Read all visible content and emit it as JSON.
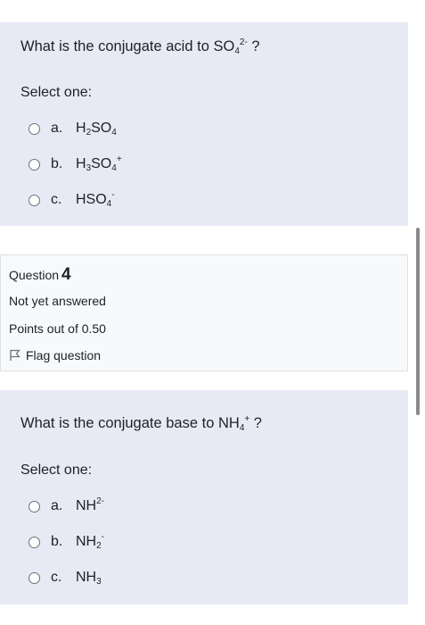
{
  "question3": {
    "text_pre": "What is the conjugate acid to SO",
    "text_sub": "4",
    "text_sup": "2-",
    "text_post": " ?",
    "select_one": "Select one:",
    "options": [
      {
        "letter": "a.",
        "p1": "H",
        "s1": "2",
        "p2": "SO",
        "s2": "4"
      },
      {
        "letter": "b.",
        "p1": "H",
        "s1": "3",
        "p2": "SO",
        "s2": "4",
        "sup": "+"
      },
      {
        "letter": "c.",
        "p1": "HSO",
        "s1": "4",
        "sup": "-"
      }
    ]
  },
  "question4": {
    "label": "Question",
    "number": "4",
    "state": "Not yet answered",
    "grade": "Points out of 0.50",
    "flag": "Flag question",
    "text_pre": "What is the conjugate base to NH",
    "text_sub": "4",
    "text_sup": "+",
    "text_post": " ?",
    "select_one": "Select one:",
    "options": [
      {
        "letter": "a.",
        "p1": "NH",
        "sup": "2-"
      },
      {
        "letter": "b.",
        "p1": "NH",
        "s1": "2",
        "sup": "-"
      },
      {
        "letter": "c.",
        "p1": "NH",
        "s1": "3"
      }
    ]
  }
}
